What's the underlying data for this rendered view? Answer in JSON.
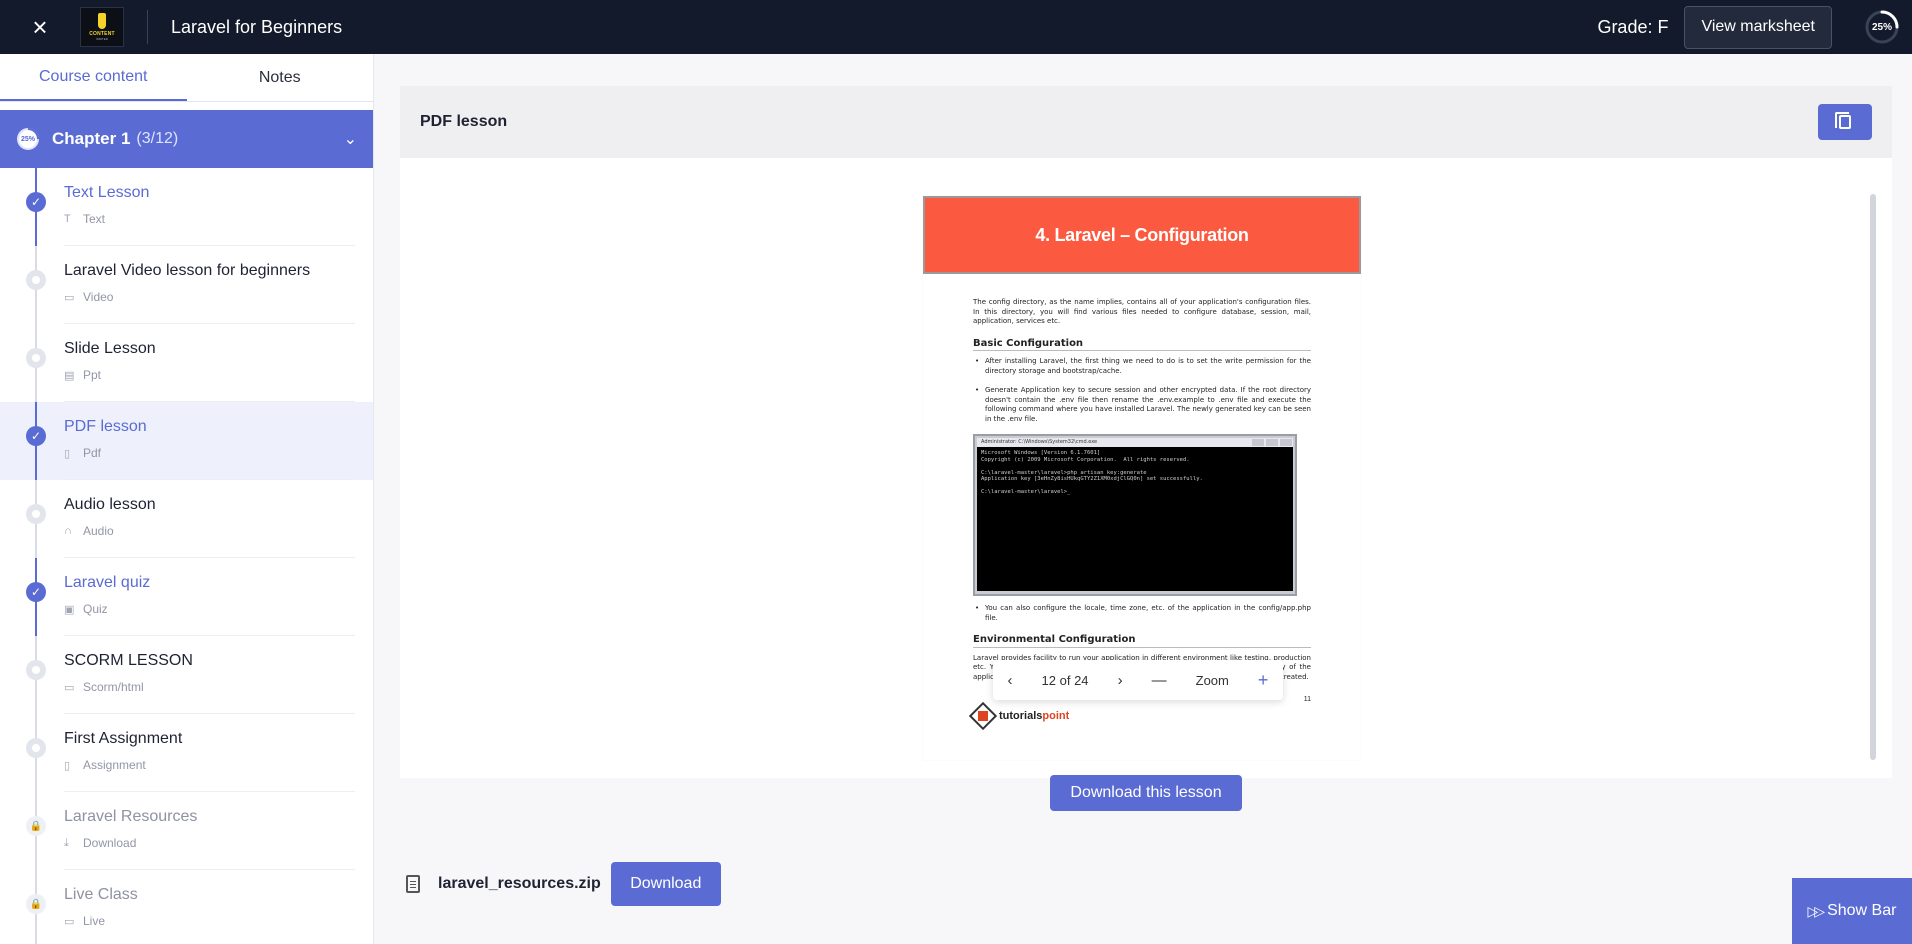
{
  "header": {
    "close_icon": "×",
    "logo_text": "CONTENT",
    "logo_sub": "WRITER",
    "course_title": "Laravel for Beginners",
    "grade": "Grade: F",
    "view_marksheet": "View marksheet",
    "progress": "25%",
    "progress_fraction": 0.25
  },
  "sidebar": {
    "tabs": [
      {
        "label": "Course content",
        "active": true
      },
      {
        "label": "Notes",
        "active": false
      }
    ],
    "chapter": {
      "progress": "25%",
      "title": "Chapter 1",
      "count": "(3/12)"
    },
    "lessons": [
      {
        "title": "Text Lesson",
        "type": "Text",
        "status": "done",
        "icon": "T"
      },
      {
        "title": "Laravel Video lesson for beginners",
        "type": "Video",
        "status": "todo",
        "icon": "▭"
      },
      {
        "title": "Slide Lesson",
        "type": "Ppt",
        "status": "todo",
        "icon": "▤"
      },
      {
        "title": "PDF lesson",
        "type": "Pdf",
        "status": "done",
        "icon": "▯"
      },
      {
        "title": "Audio lesson",
        "type": "Audio",
        "status": "todo",
        "icon": "∩"
      },
      {
        "title": "Laravel quiz",
        "type": "Quiz",
        "status": "done",
        "icon": "▣"
      },
      {
        "title": "SCORM LESSON",
        "type": "Scorm/html",
        "status": "todo",
        "icon": "▭"
      },
      {
        "title": "First Assignment",
        "type": "Assignment",
        "status": "todo",
        "icon": "▯"
      },
      {
        "title": "Laravel Resources",
        "type": "Download",
        "status": "locked",
        "icon": "⤓"
      },
      {
        "title": "Live Class",
        "type": "Live",
        "status": "locked",
        "icon": "▭"
      }
    ]
  },
  "main": {
    "lesson_title": "PDF lesson",
    "pdf": {
      "banner": "4.  Laravel – Configuration",
      "intro": "The config directory, as the name implies, contains all of your application's configuration files. In this directory, you will find various files needed to configure database, session, mail, application, services etc.",
      "heading1": "Basic Configuration",
      "bullet1": "After installing Laravel, the first thing we need to do is to set the write permission for the directory storage and bootstrap/cache.",
      "bullet2": "Generate Application key to secure session and other encrypted data. If the root directory doesn't contain the .env file then rename the .env.example to .env file and execute the following command where you have installed Laravel. The newly generated key can be seen in the .env file.",
      "terminal_title": "Administrator: C:\\Windows\\System32\\cmd.exe",
      "terminal_text": "Microsoft Windows [Version 6.1.7601]\nCopyright (c) 2009 Microsoft Corporation.  All rights reserved.\n\nC:\\laravel-master\\laravel>php artisan key:generate\nApplication key [3eHnZy8isHUkqGTY2Z1XM0xdjClGQ0n] set successfully.\n\nC:\\laravel-master\\laravel>_",
      "bullet3": "You can also configure the locale, time zone, etc. of the application in the config/app.php file.",
      "heading2": "Environmental Configuration",
      "env_text": "Laravel provides facility to run your application in different environment like testing, production etc. You can configure the environment variable in the .env file of the root directory of the application. If you have installed Laravel using composer, this file will automatically be created.",
      "page_number": "11",
      "logo_main": "tutorials",
      "logo_accent": "point"
    },
    "toolbar": {
      "prev": "‹",
      "page_indicator": "12 of 24",
      "next": "›",
      "zoom_out": "—",
      "zoom_label": "Zoom",
      "zoom_in": "+"
    },
    "download_lesson": "Download this lesson",
    "attachment": {
      "filename": "laravel_resources.zip",
      "download": "Download"
    },
    "show_bar": "Show Bar"
  }
}
